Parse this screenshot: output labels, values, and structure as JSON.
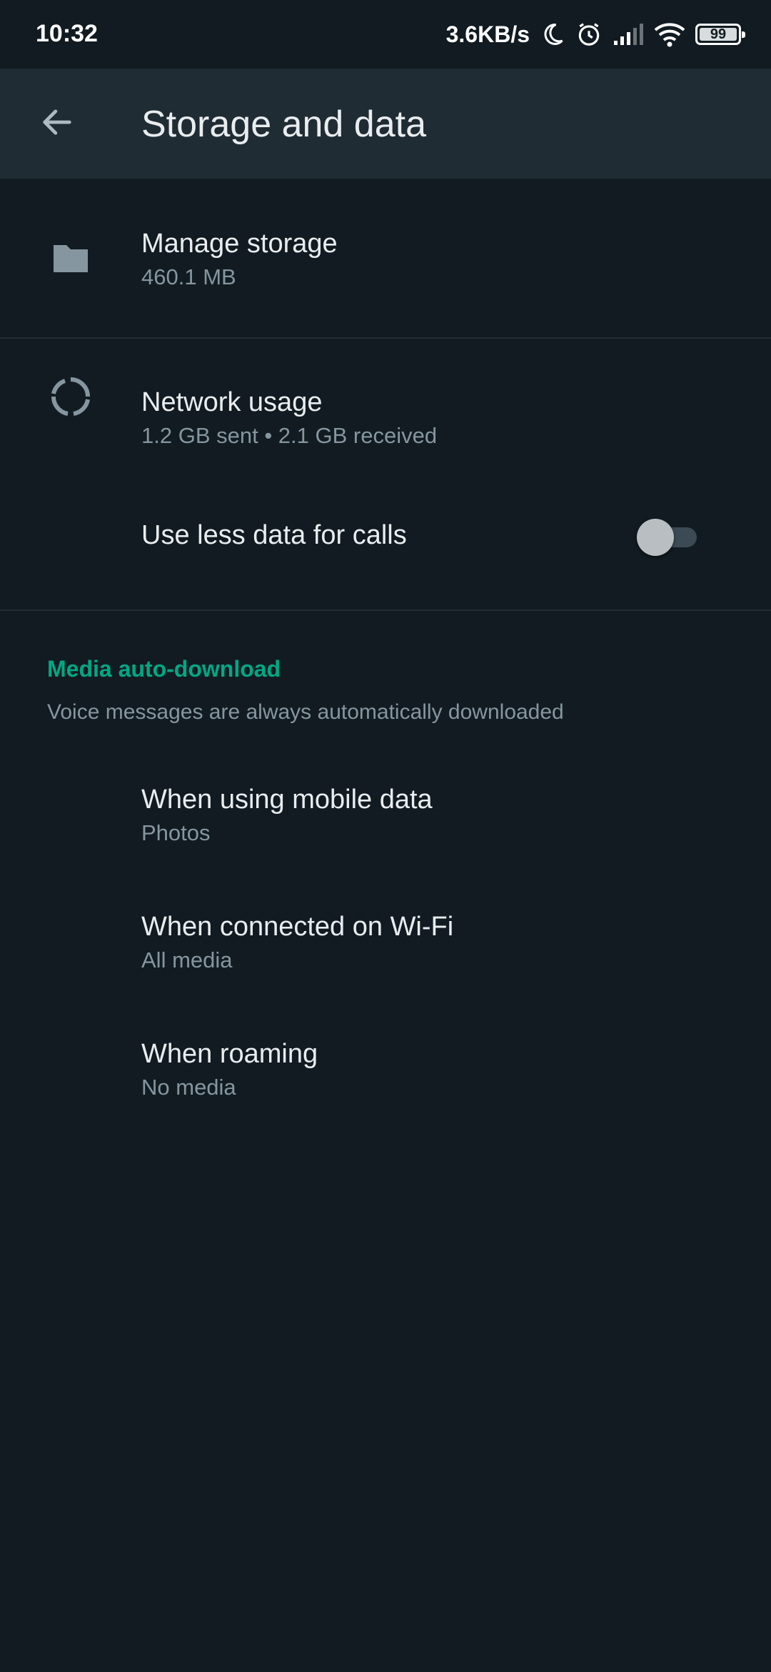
{
  "status_bar": {
    "time": "10:32",
    "net_speed": "3.6KB/s",
    "icons": [
      "moon-icon",
      "alarm-icon",
      "signal-icon",
      "wifi-icon",
      "battery-icon"
    ],
    "battery": "99"
  },
  "app_bar": {
    "back_icon": "arrow-left-icon",
    "title": "Storage and data"
  },
  "storage": {
    "icon": "folder-icon",
    "title": "Manage storage",
    "subtitle": "460.1 MB"
  },
  "network": {
    "icon": "network-usage-icon",
    "title": "Network usage",
    "subtitle": "1.2 GB sent • 2.1 GB received"
  },
  "calls": {
    "title": "Use less data for calls",
    "enabled": false
  },
  "media": {
    "header": "Media auto-download",
    "note": "Voice messages are always automatically downloaded",
    "items": [
      {
        "title": "When using mobile data",
        "value": "Photos"
      },
      {
        "title": "When connected on Wi-Fi",
        "value": "All media"
      },
      {
        "title": "When roaming",
        "value": "No media"
      }
    ]
  },
  "colors": {
    "background": "#111b21",
    "app_bar": "#202c33",
    "accent": "#00a884",
    "secondary_text": "#8696a0"
  }
}
